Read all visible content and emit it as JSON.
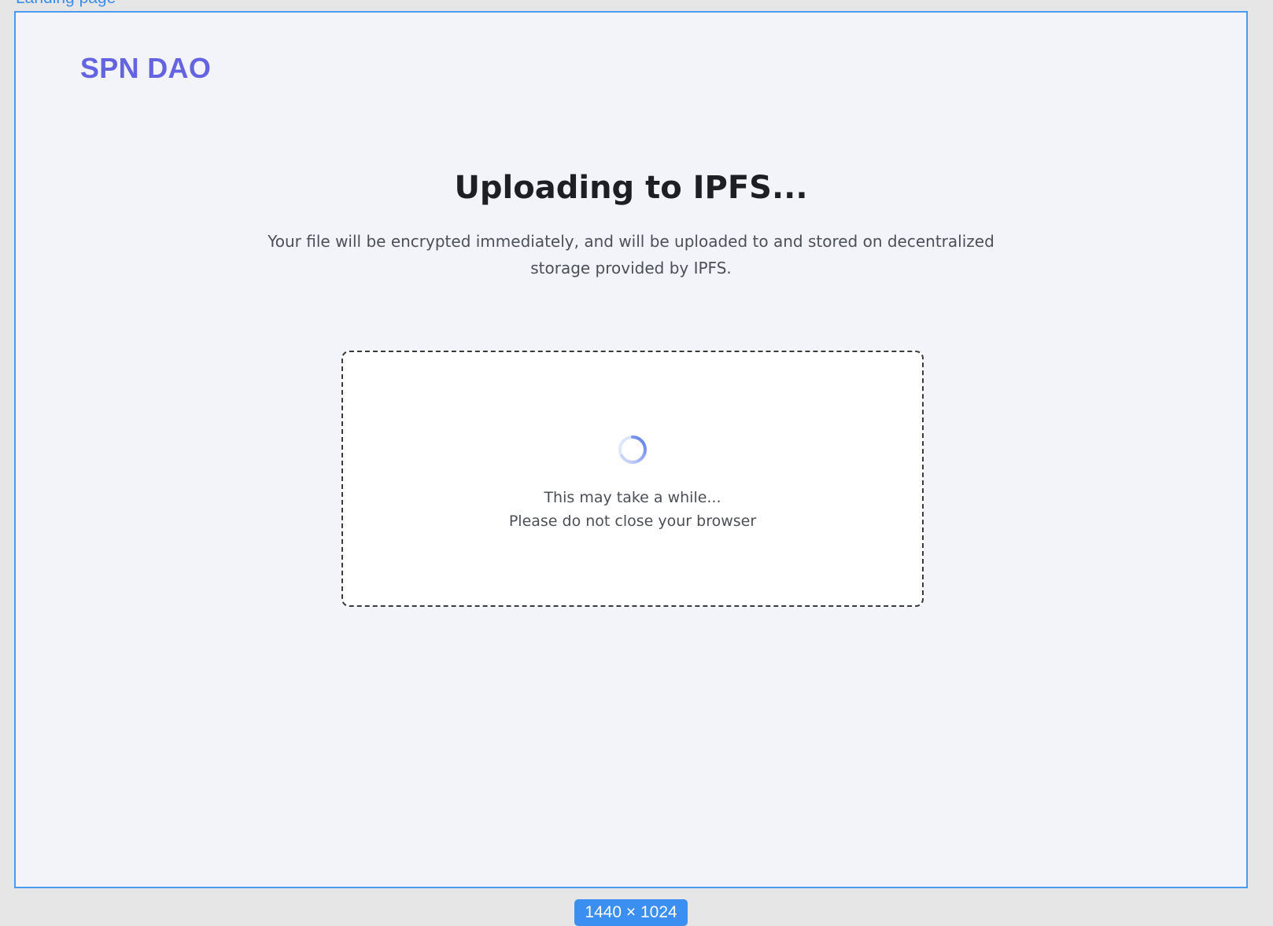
{
  "canvas": {
    "frame_label": "Landing page",
    "frame_size_badge": "1440 × 1024"
  },
  "header": {
    "brand": "SPN DAO"
  },
  "main": {
    "title": "Uploading to IPFS...",
    "subtitle": "Your file will be encrypted immediately, and will be uploaded to and stored on decentralized storage provided by IPFS."
  },
  "upload_box": {
    "spinner_icon": "loading-spinner-icon",
    "line1": "This may take a while...",
    "line2": "Please do not close your browser"
  },
  "colors": {
    "brand": "#6464e0",
    "frame_border": "#4a9af0",
    "page_bg": "#f2f4f9",
    "spinner": "#5a7be8"
  }
}
